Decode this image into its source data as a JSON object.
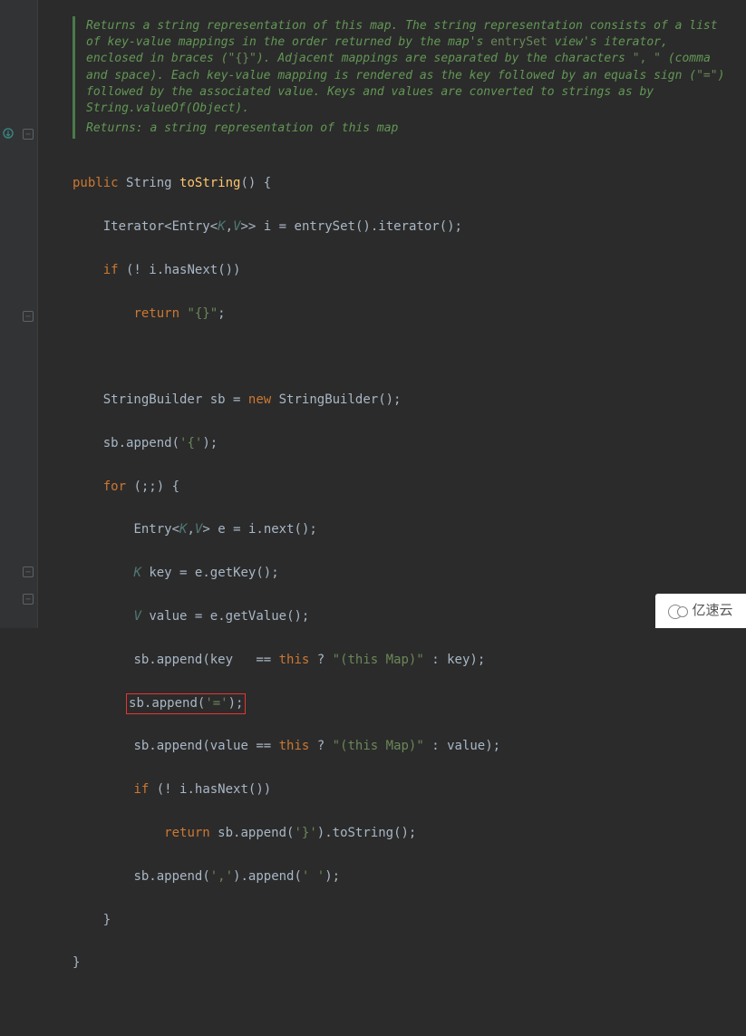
{
  "javadoc": {
    "p1": "Returns a string representation of this map. The string representation consists of a list of key-value mappings in the order returned by the map's ",
    "code1": "entrySet",
    "p2": " view's iterator, enclosed in braces (",
    "code2": "\"{}\"",
    "p3": "). Adjacent mappings are separated by the characters ",
    "code3": "\", \"",
    "p4": " (comma and space). Each key-value mapping is rendered as the key followed by an equals sign (",
    "code4": "\"=\"",
    "p5": ") followed by the associated value. Keys and values are converted to strings as by ",
    "link1": "String.valueOf(Object)",
    "p6": ".",
    "returns_label": "Returns: ",
    "returns_text": "a string representation of this map"
  },
  "tokens": {
    "public": "public",
    "Type_String": "String",
    "toString": "toString",
    "Iterator": "Iterator",
    "Entry": "Entry",
    "K": "K",
    "V": "V",
    "i": "i",
    "entrySet": "entrySet",
    "iterator": "iterator",
    "if": "if",
    "hasNext": "hasNext",
    "return": "return",
    "empty_braces": "\"{}\"",
    "StringBuilder": "StringBuilder",
    "sb": "sb",
    "new": "new",
    "append": "append",
    "char_open": "'{'",
    "for": "for",
    "e": "e",
    "next": "next",
    "key": "key",
    "getKey": "getKey",
    "value": "value",
    "getValue": "getValue",
    "this": "this",
    "this_map": "\"(this Map)\"",
    "char_eq": "'='",
    "char_close": "'}'",
    "char_comma": "','",
    "char_space": "' '"
  },
  "watermark": {
    "text": "亿速云"
  }
}
